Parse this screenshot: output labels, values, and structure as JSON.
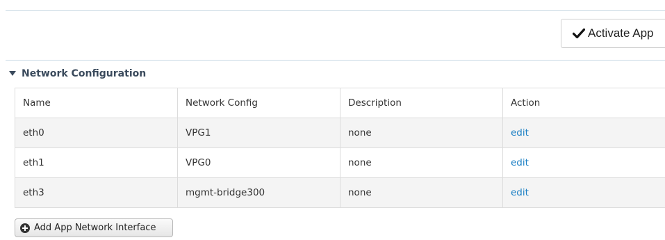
{
  "toolbar": {
    "activate_label": "Activate App",
    "activate_icon": "check-icon"
  },
  "section": {
    "title": "Network Configuration",
    "expanded": true
  },
  "table": {
    "headers": {
      "name": "Name",
      "network_config": "Network Config",
      "description": "Description",
      "action": "Action"
    },
    "rows": [
      {
        "name": "eth0",
        "network_config": "VPG1",
        "description": "none",
        "action": "edit"
      },
      {
        "name": "eth1",
        "network_config": "VPG0",
        "description": "none",
        "action": "edit"
      },
      {
        "name": "eth3",
        "network_config": "mgmt-bridge300",
        "description": "none",
        "action": "edit"
      }
    ]
  },
  "footer": {
    "add_label": "Add App Network Interface",
    "add_icon": "plus-circle-icon"
  },
  "colors": {
    "link": "#1b7fc4",
    "section_title": "#3a4a5c",
    "divider": "#c9d9e4"
  }
}
